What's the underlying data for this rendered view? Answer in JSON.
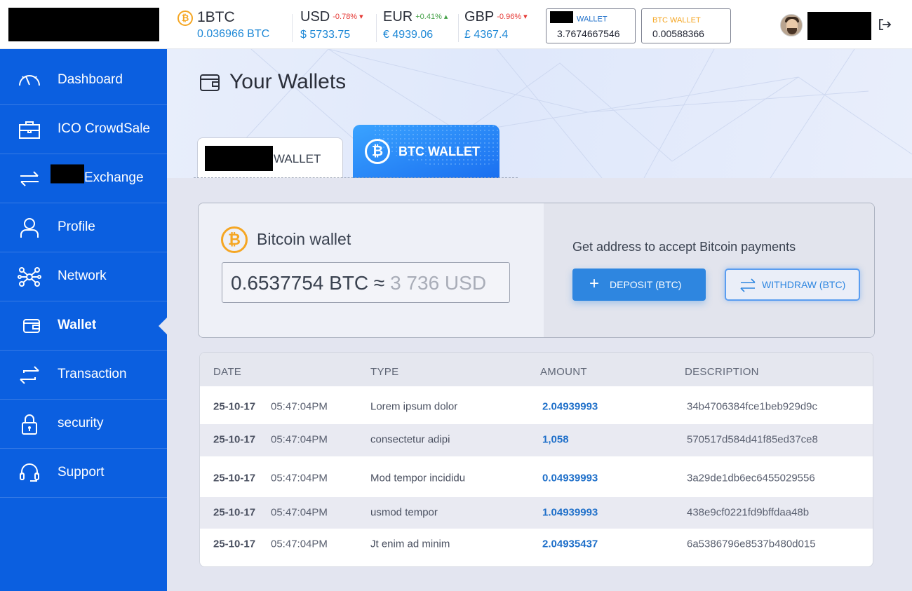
{
  "header": {
    "btc_unit": "1BTC",
    "btc_value": "0.036966 BTC",
    "btc_symbol": "₿",
    "currencies": [
      {
        "name": "USD",
        "change": "-0.78%",
        "arrow": "▾",
        "value": "$ 5733.75"
      },
      {
        "name": "EUR",
        "change": "+0.41%",
        "arrow": "▴",
        "value": "€ 4939.06"
      },
      {
        "name": "GBP",
        "change": "-0.96%",
        "arrow": "▾",
        "value": "£ 4367.4"
      }
    ],
    "wallet_label": "WALLET",
    "wallet_value": "3.7674667546",
    "btc_wallet_label": "BTC WALLET",
    "btc_wallet_value": "0.00588366"
  },
  "sidebar": {
    "items": [
      {
        "label": "Dashboard",
        "icon": "speedometer-icon"
      },
      {
        "label": "ICO CrowdSale",
        "icon": "briefcase-icon"
      },
      {
        "label": "Exchange",
        "icon": "exchange-arrows-icon"
      },
      {
        "label": "Profile",
        "icon": "user-icon"
      },
      {
        "label": "Network",
        "icon": "network-icon"
      },
      {
        "label": "Wallet",
        "icon": "wallet-icon"
      },
      {
        "label": "Transaction",
        "icon": "transaction-icon"
      },
      {
        "label": "security",
        "icon": "lock-icon"
      },
      {
        "label": "Support",
        "icon": "headset-icon"
      }
    ],
    "active": "Wallet"
  },
  "page": {
    "title": "Your Wallets",
    "tabs": [
      {
        "label": "WALLET"
      },
      {
        "label": "BTC WALLET"
      }
    ]
  },
  "wallet_card": {
    "title": "Bitcoin wallet",
    "balance_btc": "0.6537754 BTC",
    "approx": "≈",
    "balance_usd": "3 736 USD",
    "accept_text": "Get address to accept Bitcoin payments",
    "deposit_label": "DEPOSIT (BTC)",
    "withdraw_label": "WITHDRAW (BTC)"
  },
  "table": {
    "headers": [
      "DATE",
      "TYPE",
      "AMOUNT",
      "DESCRIPTION"
    ],
    "rows": [
      {
        "date": "25-10-17",
        "time": "05:47:04PM",
        "type": "Lorem ipsum dolor",
        "amount": "2.04939993",
        "desc": "34b4706384fce1beb929d9c"
      },
      {
        "date": "25-10-17",
        "time": "05:47:04PM",
        "type": "consectetur adipi",
        "amount": "1,058",
        "desc": "570517d584d41f85ed37ce8"
      },
      {
        "date": "25-10-17",
        "time": "05:47:04PM",
        "type": "Mod tempor incididu",
        "amount": "0.04939993",
        "desc": "3a29de1db6ec6455029556"
      },
      {
        "date": "25-10-17",
        "time": "05:47:04PM",
        "type": "usmod tempor",
        "amount": "1.04939993",
        "desc": "438e9cf0221fd9bffdaa48b"
      },
      {
        "date": "25-10-17",
        "time": "05:47:04PM",
        "type": "Jt enim ad minim",
        "amount": "2.04935437",
        "desc": "6a5386796e8537b480d015"
      }
    ]
  },
  "colors": {
    "sidebar": "#0b5fe0",
    "accent": "#1e88d6",
    "bitcoin": "#f5a623",
    "down": "#e53935",
    "up": "#43a047"
  }
}
